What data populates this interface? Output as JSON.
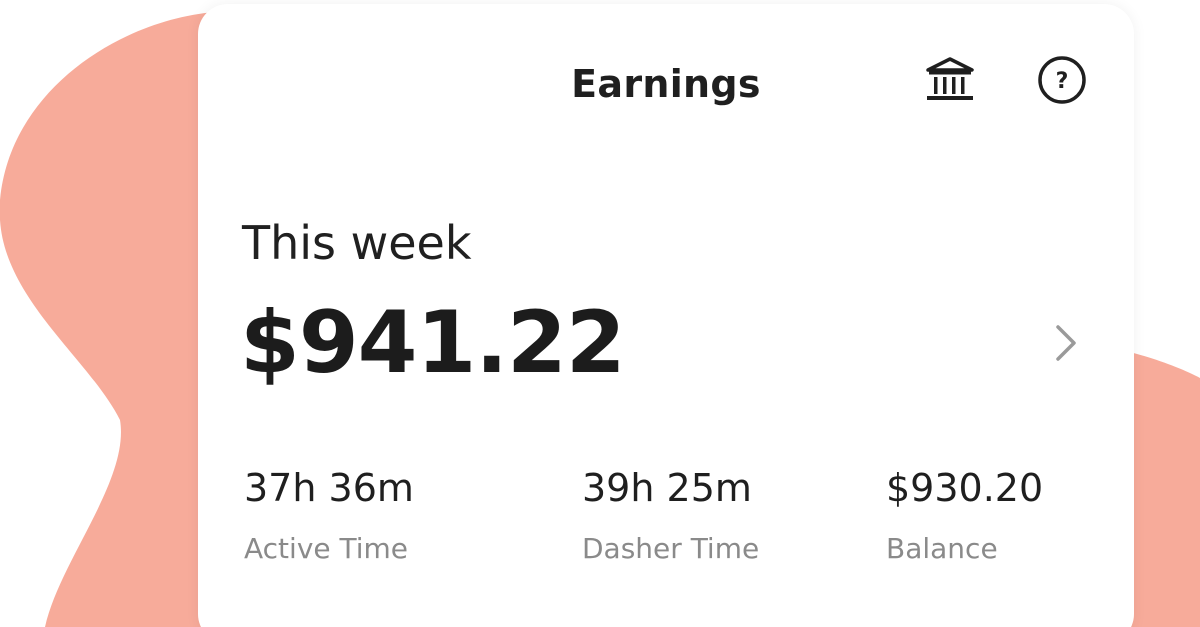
{
  "colors": {
    "background_blob": "#f7ab9a",
    "card": "#ffffff",
    "text_primary": "#1f1f1f",
    "text_secondary": "#8a8a8a",
    "chevron": "#9a9a9a"
  },
  "header": {
    "title": "Earnings",
    "icons": [
      "bank-icon",
      "help-icon"
    ],
    "help_glyph": "?"
  },
  "summary": {
    "period_label": "This week",
    "total": "$941.22"
  },
  "stats": [
    {
      "value": "37h 36m",
      "label": "Active Time"
    },
    {
      "value": "39h 25m",
      "label": "Dasher Time"
    },
    {
      "value": "$930.20",
      "label": "Balance"
    }
  ]
}
